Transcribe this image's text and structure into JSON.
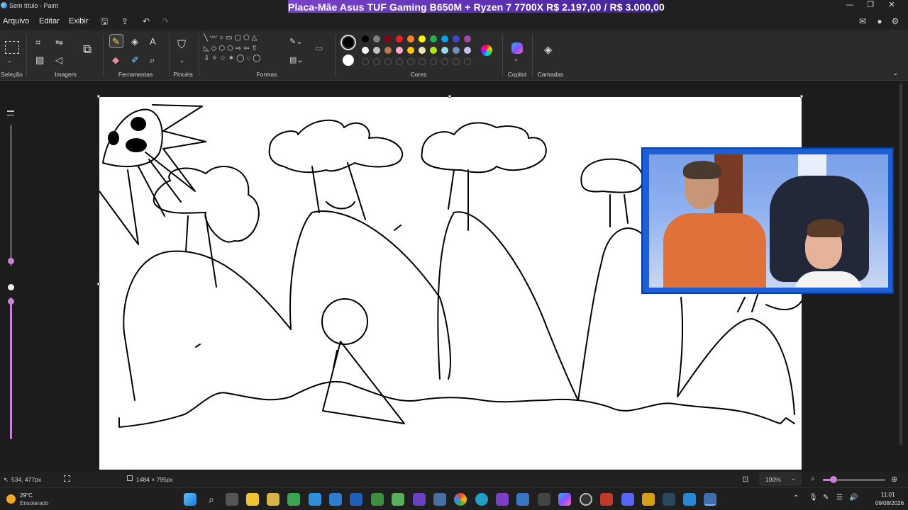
{
  "window": {
    "title": "Sem título - Paint"
  },
  "promo_banner": {
    "text": "Placa-Mãe Asus TUF Gaming B650M + Ryzen 7 7700X    R$ 2.197,00 / R$ 3.000,00"
  },
  "menu": {
    "arquivo": "Arquivo",
    "editar": "Editar",
    "exibir": "Exibir"
  },
  "ribbon": {
    "groups": {
      "selecao": "Seleção",
      "imagem": "Imagem",
      "ferramentas": "Ferramentas",
      "pinceis": "Pincéis",
      "formas": "Formas",
      "cores": "Cores",
      "copilot": "Copilot",
      "camadas": "Camadas"
    },
    "colors_row1": [
      "#000000",
      "#7f7f7f",
      "#880015",
      "#ed1c24",
      "#ff7f27",
      "#fff200",
      "#22b14c",
      "#00a2e8",
      "#3f48cc",
      "#a349a4"
    ],
    "colors_row2": [
      "#ffffff",
      "#c3c3c3",
      "#b97a57",
      "#ffaec9",
      "#ffc90e",
      "#efe4b0",
      "#b5e61d",
      "#99d9ea",
      "#7092be",
      "#c8bfe7"
    ],
    "primary_color": "#000000",
    "secondary_color": "#ffffff"
  },
  "status": {
    "cursor_pos": "534, 477px",
    "canvas_size": "1484 × 795px",
    "zoom": "100%"
  },
  "taskbar": {
    "weather_temp": "29°C",
    "weather_desc": "Ensolarado",
    "time": "11:01",
    "date": "09/08/2026"
  }
}
